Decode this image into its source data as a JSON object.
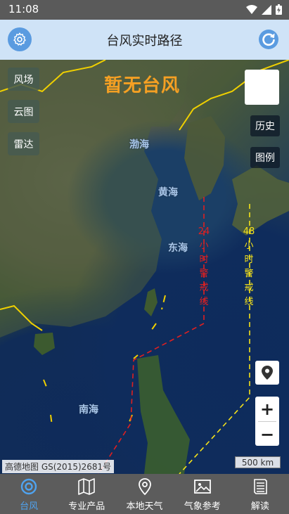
{
  "status_bar": {
    "time": "11:08"
  },
  "header": {
    "title": "台风实时路径",
    "settings_icon": "gear-icon",
    "refresh_icon": "refresh-icon",
    "accent": "#5a9be0"
  },
  "map": {
    "notice": "暂无台风",
    "layer_buttons": [
      "风场",
      "云图",
      "雷达"
    ],
    "right_buttons": [
      "历史",
      "图例"
    ],
    "sea_labels": [
      "渤海",
      "黄海",
      "东海",
      "南海"
    ],
    "warning_24": {
      "number": "24",
      "chars": [
        "小",
        "时",
        "警",
        "戒",
        "线"
      ],
      "color": "#e02020"
    },
    "warning_48": {
      "number": "48",
      "chars": [
        "小",
        "时",
        "警",
        "戒",
        "线"
      ],
      "color": "#f5e21a"
    },
    "zoom_in": "+",
    "zoom_out": "−",
    "copyright": "高德地图 GS(2015)2681号",
    "scale": "500 km"
  },
  "tabbar": {
    "tabs": [
      {
        "label": "台风",
        "icon": "typhoon-icon",
        "active": true
      },
      {
        "label": "专业产品",
        "icon": "map-icon",
        "active": false
      },
      {
        "label": "本地天气",
        "icon": "location-pin-icon",
        "active": false
      },
      {
        "label": "气象参考",
        "icon": "image-icon",
        "active": false
      },
      {
        "label": "解读",
        "icon": "book-icon",
        "active": false
      }
    ]
  }
}
